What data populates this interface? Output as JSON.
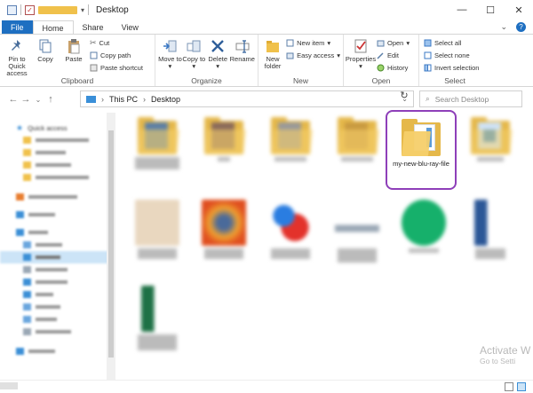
{
  "window": {
    "title": "Desktop"
  },
  "ribbon_tabs": [
    "File",
    "Home",
    "Share",
    "View"
  ],
  "ribbon": {
    "clipboard": {
      "label": "Clipboard",
      "pin": "Pin to Quick access",
      "copy": "Copy",
      "paste": "Paste",
      "cut": "Cut",
      "copy_path": "Copy path",
      "paste_shortcut": "Paste shortcut"
    },
    "organize": {
      "label": "Organize",
      "move_to": "Move to",
      "copy_to": "Copy to",
      "delete": "Delete",
      "rename": "Rename"
    },
    "new": {
      "label": "New",
      "new_folder": "New folder",
      "new_item": "New item",
      "easy_access": "Easy access"
    },
    "open": {
      "label": "Open",
      "properties": "Properties",
      "open": "Open",
      "edit": "Edit",
      "history": "History"
    },
    "select": {
      "label": "Select",
      "select_all": "Select all",
      "select_none": "Select none",
      "invert_selection": "Invert selection"
    }
  },
  "address": {
    "root": "This PC",
    "current": "Desktop",
    "search_placeholder": "Search Desktop"
  },
  "nav_pane": {
    "quick_access": "Quick access"
  },
  "files": {
    "highlighted": "my-new-blu-ray-file"
  },
  "watermark": {
    "line1": "Activate W",
    "line2": "Go to Setti"
  },
  "colors": {
    "accent": "#1e6fc1",
    "highlight_border": "#8e3fb9",
    "folder": "#e5b84a",
    "selected_nav": "#cce4f7"
  }
}
